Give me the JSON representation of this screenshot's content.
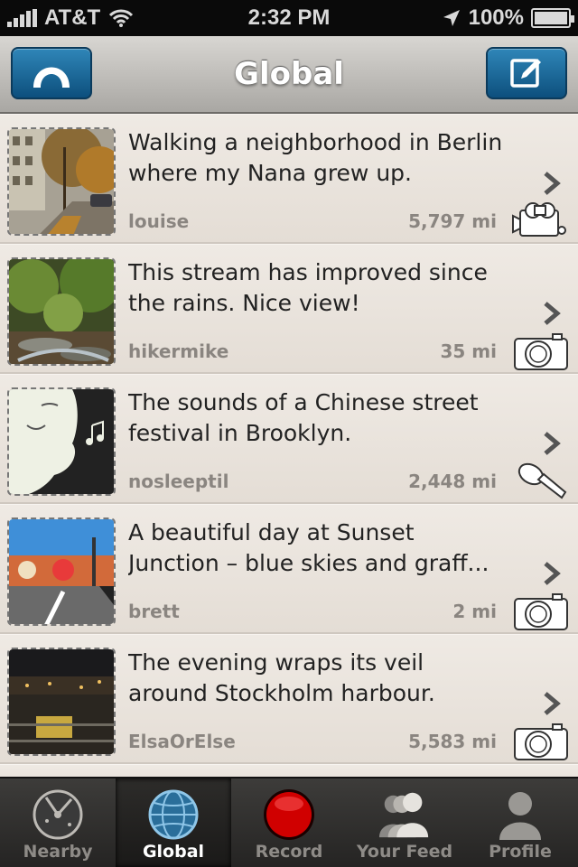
{
  "status_bar": {
    "carrier": "AT&T",
    "time": "2:32 PM",
    "battery": "100%"
  },
  "nav": {
    "title": "Global",
    "left_icon": "arch-logo-icon",
    "right_icon": "compose-icon"
  },
  "items": [
    {
      "title": "Walking a neighborhood in Berlin where my Nana grew up.",
      "user": "louise",
      "distance": "5,797 mi",
      "media": "video-camera-icon"
    },
    {
      "title": "This stream has improved since the rains. Nice view!",
      "user": "hikermike",
      "distance": "35 mi",
      "media": "camera-icon"
    },
    {
      "title": "The sounds of a Chinese street festival in Brooklyn.",
      "user": "nosleeptil",
      "distance": "2,448 mi",
      "media": "microphone-icon"
    },
    {
      "title": "A beautiful day at Sunset Junction – blue skies and graff...",
      "user": "brett",
      "distance": "2 mi",
      "media": "camera-icon"
    },
    {
      "title": "The evening wraps its veil around Stockholm harbour.",
      "user": "ElsaOrElse",
      "distance": "5,583 mi",
      "media": "camera-icon"
    }
  ],
  "tabs": [
    {
      "label": "Nearby",
      "icon": "radar-icon",
      "active": false
    },
    {
      "label": "Global",
      "icon": "globe-icon",
      "active": true
    },
    {
      "label": "Record",
      "icon": "record-icon",
      "active": false
    },
    {
      "label": "Your Feed",
      "icon": "people-icon",
      "active": false
    },
    {
      "label": "Profile",
      "icon": "person-icon",
      "active": false
    }
  ],
  "colors": {
    "accent_blue": "#1a6a9e",
    "record_red": "#d00000",
    "row_background": "#ebe5de",
    "meta_text": "#8a8580"
  }
}
